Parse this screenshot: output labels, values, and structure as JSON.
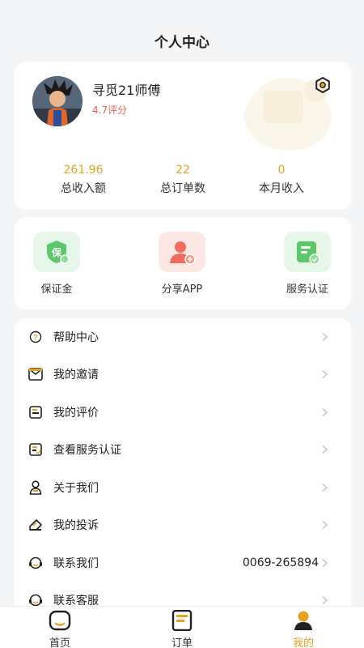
{
  "header": {
    "title": "个人中心"
  },
  "profile": {
    "name": "寻觅21师傅",
    "rating": "4.7评分"
  },
  "stats": [
    {
      "value": "261.96",
      "label": "总收入额"
    },
    {
      "value": "22",
      "label": "总订单数"
    },
    {
      "value": "0",
      "label": "本月收入"
    }
  ],
  "actions": [
    {
      "label": "保证金",
      "icon": "deposit-shield-icon",
      "color": "#5cc86a"
    },
    {
      "label": "分享APP",
      "icon": "share-user-icon",
      "color": "#f36b5e"
    },
    {
      "label": "服务认证",
      "icon": "certificate-icon",
      "color": "#5cc86a"
    }
  ],
  "menu": [
    {
      "label": "帮助中心",
      "icon": "help-icon"
    },
    {
      "label": "我的邀请",
      "icon": "envelope-icon"
    },
    {
      "label": "我的评价",
      "icon": "review-icon"
    },
    {
      "label": "查看服务认证",
      "icon": "certificate-outline-icon"
    },
    {
      "label": "关于我们",
      "icon": "person-icon"
    },
    {
      "label": "我的投诉",
      "icon": "complaint-icon"
    },
    {
      "label": "联系我们",
      "icon": "headset-icon",
      "value": "0069-265894"
    },
    {
      "label": "联系客服",
      "icon": "customer-service-icon"
    }
  ],
  "tabs": [
    {
      "label": "首页",
      "icon": "home-icon",
      "active": false
    },
    {
      "label": "订单",
      "icon": "orders-icon",
      "active": false
    },
    {
      "label": "我的",
      "icon": "profile-icon",
      "active": true
    }
  ],
  "colors": {
    "accent": "#e8a11e",
    "rating": "#e2605a",
    "background": "#f4f5f7"
  }
}
